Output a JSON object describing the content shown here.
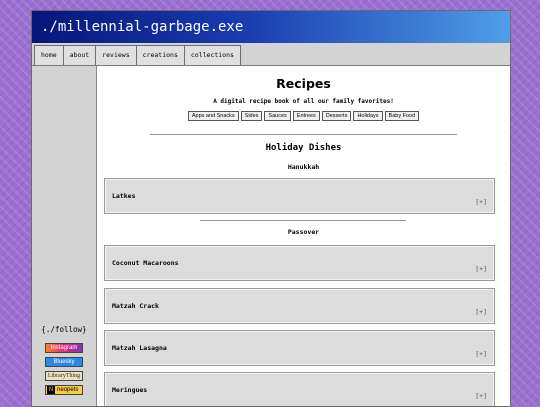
{
  "site": {
    "title": "./millennial-garbage.exe"
  },
  "nav": [
    {
      "label": "home"
    },
    {
      "label": "about"
    },
    {
      "label": "reviews"
    },
    {
      "label": "creations"
    },
    {
      "label": "collections"
    }
  ],
  "sidebar": {
    "follow_title": "{./follow}",
    "socials": [
      {
        "label": "Instagram"
      },
      {
        "label": "Bluesky"
      },
      {
        "label": "LibraryThing"
      },
      {
        "label": "neopets"
      }
    ]
  },
  "page": {
    "title": "Recipes",
    "subtitle": "A digital recipe book of all our family favorites!",
    "categories": [
      "Apps and Snacks",
      "Sides",
      "Sauces",
      "Entrees",
      "Desserts",
      "Holidays",
      "Baby Food"
    ]
  },
  "section": {
    "title": "Holiday Dishes",
    "groups": [
      {
        "name": "Hanukkah",
        "recipes": [
          {
            "label": "Latkes",
            "toggle": "[+]"
          }
        ]
      },
      {
        "name": "Passover",
        "recipes": [
          {
            "label": "Coconut Macaroons",
            "toggle": "[+]"
          },
          {
            "label": "Matzah Crack",
            "toggle": "[+]"
          },
          {
            "label": "Matzah Lasagna",
            "toggle": "[+]"
          },
          {
            "label": "Meringues",
            "toggle": "[+]"
          }
        ]
      }
    ]
  },
  "colors": {
    "titlebar_start": "#06167a",
    "titlebar_end": "#4f9ee6",
    "background": "#9b6fd0"
  }
}
